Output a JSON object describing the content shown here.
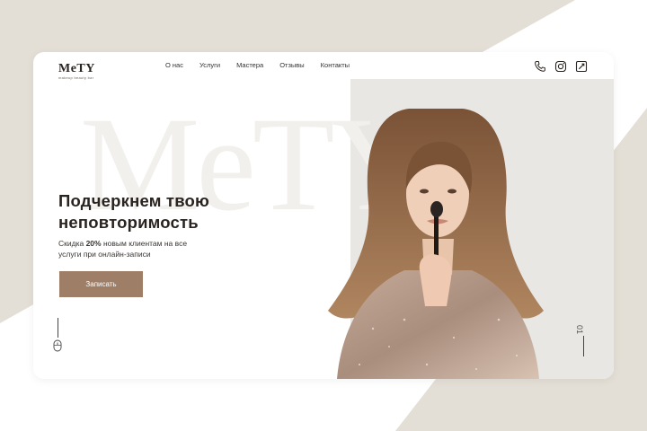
{
  "logo": {
    "title": "MeTY",
    "subtitle": "makeup beauty bar"
  },
  "nav": {
    "items": [
      {
        "label": "О нас"
      },
      {
        "label": "Услуги"
      },
      {
        "label": "Мастера"
      },
      {
        "label": "Отзывы"
      },
      {
        "label": "Контакты"
      }
    ]
  },
  "header_icons": [
    "phone-icon",
    "instagram-icon",
    "booking-icon"
  ],
  "watermark": "MeTY",
  "hero": {
    "title_line1": "Подчеркнем твою",
    "title_line2": "неповторимость",
    "sub_prefix": "Скидка ",
    "sub_discount": "20%",
    "sub_line1_rest": " новым клиентам на все",
    "sub_line2": "услуги при онлайн-записи",
    "cta_label": "Записать"
  },
  "slider": {
    "current": "01"
  },
  "colors": {
    "accent": "#9e7e67",
    "page_bg": "#e4dfd6",
    "text": "#2a2420",
    "photo_bg": "#e9e7e4"
  }
}
